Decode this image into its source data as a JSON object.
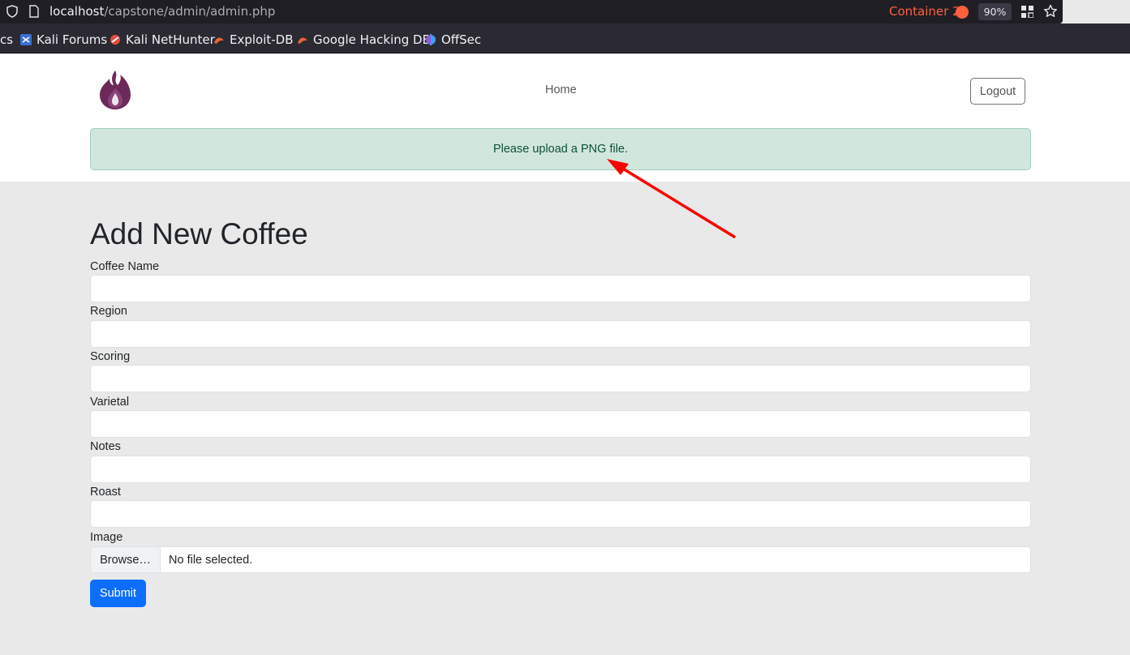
{
  "browser": {
    "url_host": "localhost",
    "url_path": "/capstone/admin/admin.php",
    "container_label": "Container 2",
    "zoom": "90%",
    "bookmarks": [
      {
        "label": "cs",
        "icon": "truncated"
      },
      {
        "label": "Kali Forums",
        "icon": "kali-forums-icon"
      },
      {
        "label": "Kali NetHunter",
        "icon": "nethunter-icon"
      },
      {
        "label": "Exploit-DB",
        "icon": "exploit-db-icon"
      },
      {
        "label": "Google Hacking DB",
        "icon": "ghdb-icon"
      },
      {
        "label": "OffSec",
        "icon": "offsec-icon"
      }
    ]
  },
  "header": {
    "nav_home": "Home",
    "logout_label": "Logout"
  },
  "alert": {
    "message": "Please upload a PNG file."
  },
  "form": {
    "title": "Add New Coffee",
    "fields": [
      {
        "label": "Coffee Name",
        "value": ""
      },
      {
        "label": "Region",
        "value": ""
      },
      {
        "label": "Scoring",
        "value": ""
      },
      {
        "label": "Varietal",
        "value": ""
      },
      {
        "label": "Notes",
        "value": ""
      },
      {
        "label": "Roast",
        "value": ""
      }
    ],
    "image_label": "Image",
    "browse_label": "Browse…",
    "file_status": "No file selected.",
    "submit_label": "Submit"
  },
  "colors": {
    "alert_bg": "#d1e7dd",
    "alert_text": "#0f5132",
    "primary": "#0d6efd",
    "container": "#ff613d",
    "arrow": "#ff0000"
  }
}
